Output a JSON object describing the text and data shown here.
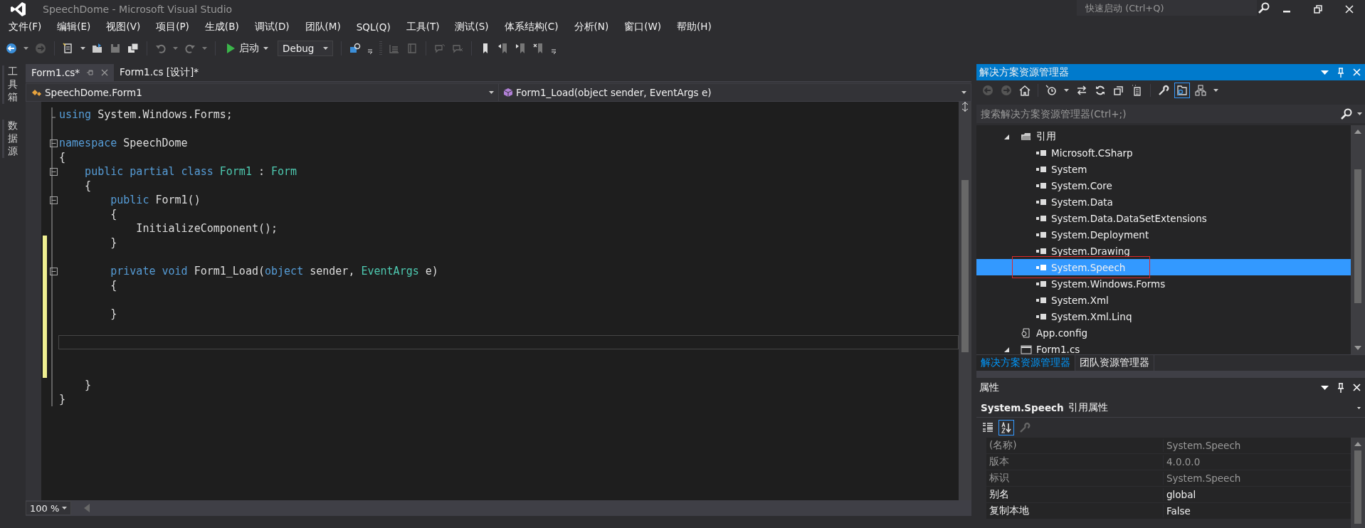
{
  "window": {
    "title": "SpeechDome - Microsoft Visual Studio",
    "quick_launch": {
      "placeholder": "快速启动 (Ctrl+Q)"
    }
  },
  "menu": [
    "文件(F)",
    "编辑(E)",
    "视图(V)",
    "项目(P)",
    "生成(B)",
    "调试(D)",
    "团队(M)",
    "SQL(Q)",
    "工具(T)",
    "测试(S)",
    "体系结构(C)",
    "分析(N)",
    "窗口(W)",
    "帮助(H)"
  ],
  "toolbar": {
    "start": "启动",
    "configuration": "Debug"
  },
  "side_tabs": [
    "工具箱",
    "数据源"
  ],
  "editor": {
    "tabs": [
      {
        "label": "Form1.cs*",
        "selected": true
      },
      {
        "label": "Form1.cs [设计]*",
        "selected": false
      }
    ],
    "navigation": {
      "type": "SpeechDome.Form1",
      "member": "Form1_Load(object sender, EventArgs e)"
    },
    "lines": [
      {
        "tokens": [
          {
            "text": "using",
            "kind": "keyword"
          },
          {
            "text": " System.Windows.Forms;",
            "kind": "plain"
          }
        ]
      },
      {
        "kind": "blank"
      },
      {
        "tokens": [
          {
            "text": "namespace",
            "kind": "keyword"
          },
          {
            "text": " SpeechDome",
            "kind": "plain"
          }
        ],
        "collapsible": true
      },
      {
        "tokens": [
          {
            "text": "{",
            "kind": "plain"
          }
        ]
      },
      {
        "tokens": [
          {
            "text": "    public partial class",
            "kind": "keyword"
          },
          {
            "text": " Form1",
            "kind": "type"
          },
          {
            "text": " : ",
            "kind": "plain"
          },
          {
            "text": "Form",
            "kind": "type"
          }
        ],
        "collapsible": true
      },
      {
        "tokens": [
          {
            "text": "    {",
            "kind": "plain"
          }
        ]
      },
      {
        "tokens": [
          {
            "text": "        public",
            "kind": "keyword"
          },
          {
            "text": " Form1()",
            "kind": "plain"
          }
        ],
        "collapsible": true
      },
      {
        "tokens": [
          {
            "text": "        {",
            "kind": "plain"
          }
        ]
      },
      {
        "tokens": [
          {
            "text": "            InitializeComponent();",
            "kind": "plain"
          }
        ]
      },
      {
        "tokens": [
          {
            "text": "        }",
            "kind": "plain"
          }
        ],
        "changed": true
      },
      {
        "kind": "blank",
        "changed": true
      },
      {
        "tokens": [
          {
            "text": "        private void",
            "kind": "keyword"
          },
          {
            "text": " Form1_Load(",
            "kind": "plain"
          },
          {
            "text": "object",
            "kind": "keyword"
          },
          {
            "text": " sender, ",
            "kind": "plain"
          },
          {
            "text": "EventArgs",
            "kind": "type"
          },
          {
            "text": " e)",
            "kind": "plain"
          }
        ],
        "collapsible": true,
        "changed": true
      },
      {
        "tokens": [
          {
            "text": "        {",
            "kind": "plain"
          }
        ],
        "changed": true
      },
      {
        "kind": "blank",
        "changed": true
      },
      {
        "tokens": [
          {
            "text": "        }",
            "kind": "plain"
          }
        ],
        "changed": true
      },
      {
        "kind": "blank",
        "changed": true
      },
      {
        "kind": "blank",
        "changed": true,
        "current": true
      },
      {
        "kind": "blank",
        "changed": true
      },
      {
        "kind": "blank",
        "changed": true
      },
      {
        "tokens": [
          {
            "text": "    }",
            "kind": "plain"
          }
        ]
      },
      {
        "tokens": [
          {
            "text": "}",
            "kind": "plain"
          }
        ]
      }
    ],
    "zoom": "100 %"
  },
  "solution_explorer": {
    "title": "解决方案资源管理器",
    "search": {
      "placeholder": "搜索解决方案资源管理器(Ctrl+;)"
    },
    "tree": [
      {
        "label": "引用",
        "kind": "references",
        "expanded": true,
        "selected": false,
        "children": [
          {
            "label": "Microsoft.CSharp",
            "kind": "reference",
            "selected": false,
            "boxed": false
          },
          {
            "label": "System",
            "kind": "reference",
            "selected": false,
            "boxed": false
          },
          {
            "label": "System.Core",
            "kind": "reference",
            "selected": false,
            "boxed": false
          },
          {
            "label": "System.Data",
            "kind": "reference",
            "selected": false,
            "boxed": false
          },
          {
            "label": "System.Data.DataSetExtensions",
            "kind": "reference",
            "selected": false,
            "boxed": false
          },
          {
            "label": "System.Deployment",
            "kind": "reference",
            "selected": false,
            "boxed": false
          },
          {
            "label": "System.Drawing",
            "kind": "reference",
            "selected": false,
            "boxed": false
          },
          {
            "label": "System.Speech",
            "kind": "reference",
            "selected": true,
            "boxed": true
          },
          {
            "label": "System.Windows.Forms",
            "kind": "reference",
            "selected": false,
            "boxed": false
          },
          {
            "label": "System.Xml",
            "kind": "reference",
            "selected": false,
            "boxed": false
          },
          {
            "label": "System.Xml.Linq",
            "kind": "reference",
            "selected": false,
            "boxed": false
          }
        ]
      },
      {
        "label": "App.config",
        "kind": "config",
        "selected": false
      },
      {
        "label": "Form1.cs",
        "kind": "form",
        "expanded": true,
        "selected": false
      }
    ],
    "tabs": [
      {
        "label": "解决方案资源管理器",
        "selected": true
      },
      {
        "label": "团队资源管理器",
        "selected": false
      }
    ]
  },
  "properties": {
    "title": "属性",
    "object": "System.Speech",
    "object_type": "引用属性",
    "rows": [
      {
        "name": "(名称)",
        "value": "System.Speech",
        "readonly": true
      },
      {
        "name": "版本",
        "value": "4.0.0.0",
        "readonly": true
      },
      {
        "name": "标识",
        "value": "System.Speech",
        "readonly": true
      },
      {
        "name": "别名",
        "value": "global",
        "readonly": false
      },
      {
        "name": "复制本地",
        "value": "False",
        "readonly": false
      }
    ]
  }
}
